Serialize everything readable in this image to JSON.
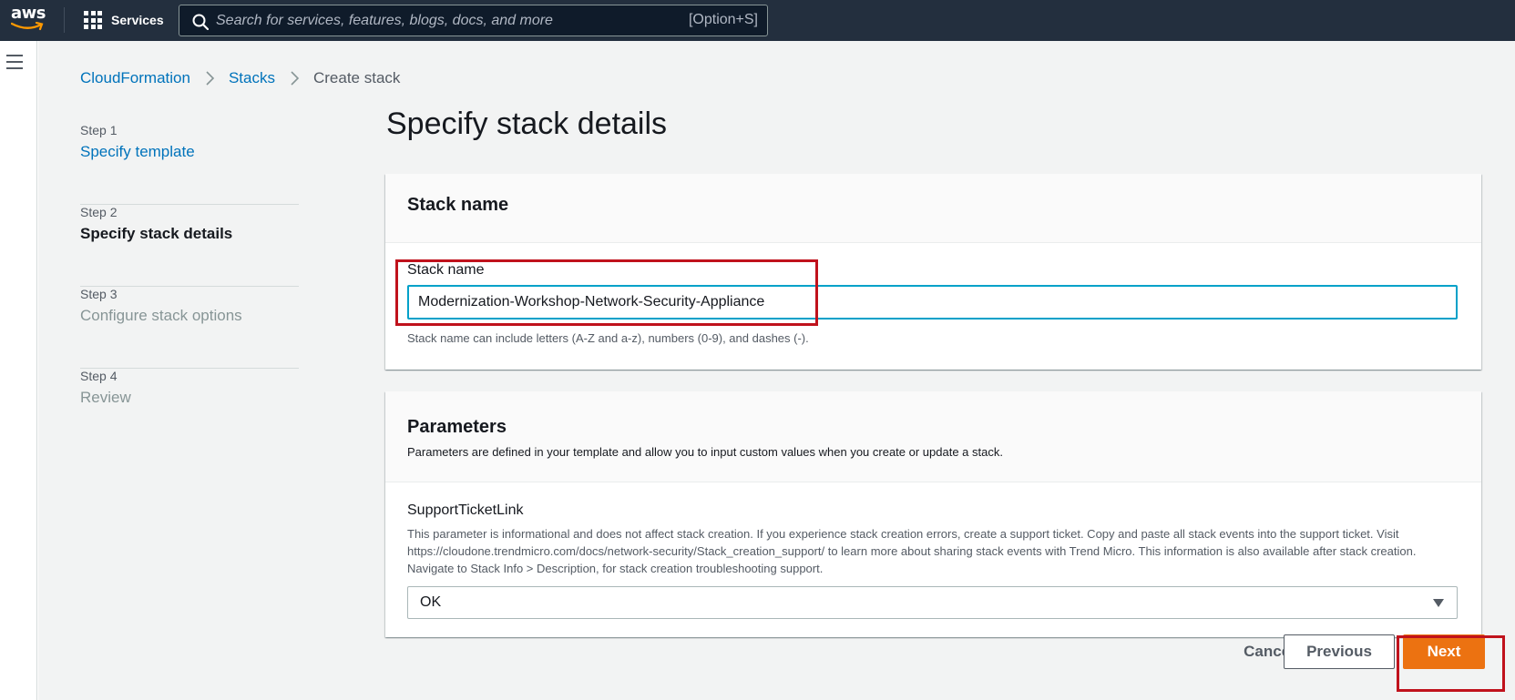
{
  "nav": {
    "logo_text": "aws",
    "services_label": "Services",
    "search_placeholder": "Search for services, features, blogs, docs, and more",
    "search_shortcut": "[Option+S]"
  },
  "breadcrumb": {
    "items": [
      "CloudFormation",
      "Stacks"
    ],
    "current": "Create stack"
  },
  "steps": [
    {
      "num": "Step 1",
      "title": "Specify template"
    },
    {
      "num": "Step 2",
      "title": "Specify stack details"
    },
    {
      "num": "Step 3",
      "title": "Configure stack options"
    },
    {
      "num": "Step 4",
      "title": "Review"
    }
  ],
  "page_title": "Specify stack details",
  "stack_name_panel": {
    "heading": "Stack name",
    "field_label": "Stack name",
    "value": "Modernization-Workshop-Network-Security-Appliance",
    "hint": "Stack name can include letters (A-Z and a-z), numbers (0-9), and dashes (-)."
  },
  "parameters_panel": {
    "heading": "Parameters",
    "description": "Parameters are defined in your template and allow you to input custom values when you create or update a stack.",
    "param_label": "SupportTicketLink",
    "param_description": "This parameter is informational and does not affect stack creation. If you experience stack creation errors, create a support ticket. Copy and paste all stack events into the support ticket. Visit https://cloudone.trendmicro.com/docs/network-security/Stack_creation_support/ to learn more about sharing stack events with Trend Micro. This information is also available after stack creation. Navigate to Stack Info > Description, for stack creation troubleshooting support.",
    "select_value": "OK"
  },
  "buttons": {
    "cancel": "Cancel",
    "previous": "Previous",
    "next": "Next"
  },
  "colors": {
    "nav_bg": "#232f3e",
    "link": "#0073bb",
    "primary": "#ec7211",
    "highlight": "#c0121c",
    "input_focus": "#00a1c9"
  }
}
